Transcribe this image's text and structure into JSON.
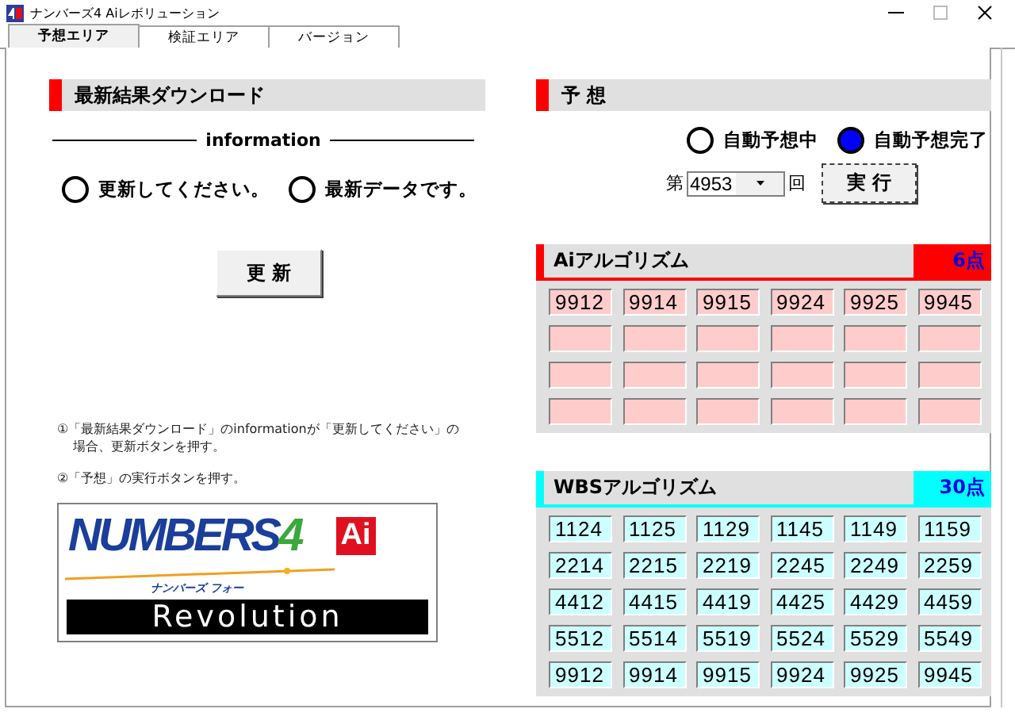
{
  "window": {
    "title": "ナンバーズ4 Aiレボリューション"
  },
  "tabs": [
    {
      "label": "予想エリア",
      "selected": true
    },
    {
      "label": "検証エリア",
      "selected": false
    },
    {
      "label": "バージョン",
      "selected": false
    }
  ],
  "download": {
    "title": "最新結果ダウンロード",
    "info_label": "information",
    "options": [
      {
        "label": "更新してください。",
        "selected": false
      },
      {
        "label": "最新データです。",
        "selected": false
      }
    ],
    "button": "更 新"
  },
  "notes": [
    "①「最新結果ダウンロード」のinformationが「更新してください」の場合、更新ボタンを押す。",
    "②「予想」の実行ボタンを押す。"
  ],
  "logo": {
    "wordmark": "NUMBERS4",
    "badge": "Ai",
    "reading": "ナンバーズ フォー",
    "subtitle": "Revolution"
  },
  "predict": {
    "title": "予 想",
    "status": [
      {
        "label": "自動予想中",
        "selected": false
      },
      {
        "label": "自動予想完了",
        "selected": true
      }
    ],
    "round_prefix": "第",
    "round": "4953",
    "round_suffix": "回",
    "button": "実 行"
  },
  "results": [
    {
      "title": "Aiアルゴリズム",
      "count": "6点",
      "color": "#ff0000",
      "cells": [
        {
          "text": "9912"
        },
        {
          "text": "9914"
        },
        {
          "text": "9915"
        },
        {
          "text": "9924"
        },
        {
          "text": "9925"
        },
        {
          "text": "9945"
        },
        {},
        {},
        {},
        {},
        {},
        {},
        {},
        {},
        {},
        {},
        {},
        {},
        {},
        {},
        {},
        {},
        {},
        {}
      ]
    },
    {
      "title": "WBSアルゴリズム",
      "count": "30点",
      "color": "#00ffff",
      "cells": [
        {
          "text": "1124"
        },
        {
          "text": "1125"
        },
        {
          "text": "1129"
        },
        {
          "text": "1145"
        },
        {
          "text": "1149"
        },
        {
          "text": "1159"
        },
        {
          "text": "2214"
        },
        {
          "text": "2215"
        },
        {
          "text": "2219"
        },
        {
          "text": "2245"
        },
        {
          "text": "2249"
        },
        {
          "text": "2259"
        },
        {
          "text": "4412"
        },
        {
          "text": "4415"
        },
        {
          "text": "4419"
        },
        {
          "text": "4425"
        },
        {
          "text": "4429"
        },
        {
          "text": "4459"
        },
        {
          "text": "5512"
        },
        {
          "text": "5514"
        },
        {
          "text": "5519"
        },
        {
          "text": "5524"
        },
        {
          "text": "5529"
        },
        {
          "text": "5549"
        },
        {
          "text": "9912"
        },
        {
          "text": "9914"
        },
        {
          "text": "9915"
        },
        {
          "text": "9924"
        },
        {
          "text": "9925"
        },
        {
          "text": "9945"
        }
      ]
    }
  ]
}
